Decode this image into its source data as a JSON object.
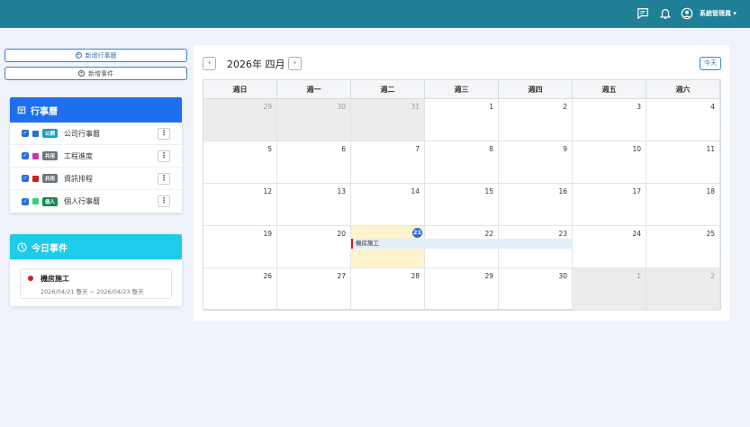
{
  "header": {
    "user_name": "系統管理員"
  },
  "sidebar": {
    "new_calendar_label": "新增行事曆",
    "new_event_label": "新增事件",
    "calendars_title": "行事曆",
    "calendars": [
      {
        "badge": "公開",
        "badge_color": "#17a2c5",
        "color": "#2c6fd6",
        "name": "公司行事曆"
      },
      {
        "badge": "共用",
        "badge_color": "#6c757d",
        "color": "#d32fb0",
        "name": "工程進度"
      },
      {
        "badge": "共用",
        "badge_color": "#6c757d",
        "color": "#c82020",
        "name": "資訊排程"
      },
      {
        "badge": "個人",
        "badge_color": "#198754",
        "color": "#2fd47a",
        "name": "個人行事曆"
      }
    ],
    "today_title": "今日事件",
    "today_events": [
      {
        "title": "機房施工",
        "time": "2026/04/21 整天 ~ 2026/04/23 整天"
      }
    ]
  },
  "calendar": {
    "title": "2026年 四月",
    "today_label": "今天",
    "weekdays": [
      "週日",
      "週一",
      "週二",
      "週三",
      "週四",
      "週五",
      "週六"
    ],
    "weeks": [
      [
        29,
        30,
        31,
        1,
        2,
        3,
        4
      ],
      [
        5,
        6,
        7,
        8,
        9,
        10,
        11
      ],
      [
        12,
        13,
        14,
        15,
        16,
        17,
        18
      ],
      [
        19,
        20,
        21,
        22,
        23,
        24,
        25
      ],
      [
        26,
        27,
        28,
        29,
        30,
        1,
        2
      ]
    ],
    "today": 21,
    "events": [
      {
        "title": "機房施工",
        "color": "#c82020"
      }
    ]
  }
}
